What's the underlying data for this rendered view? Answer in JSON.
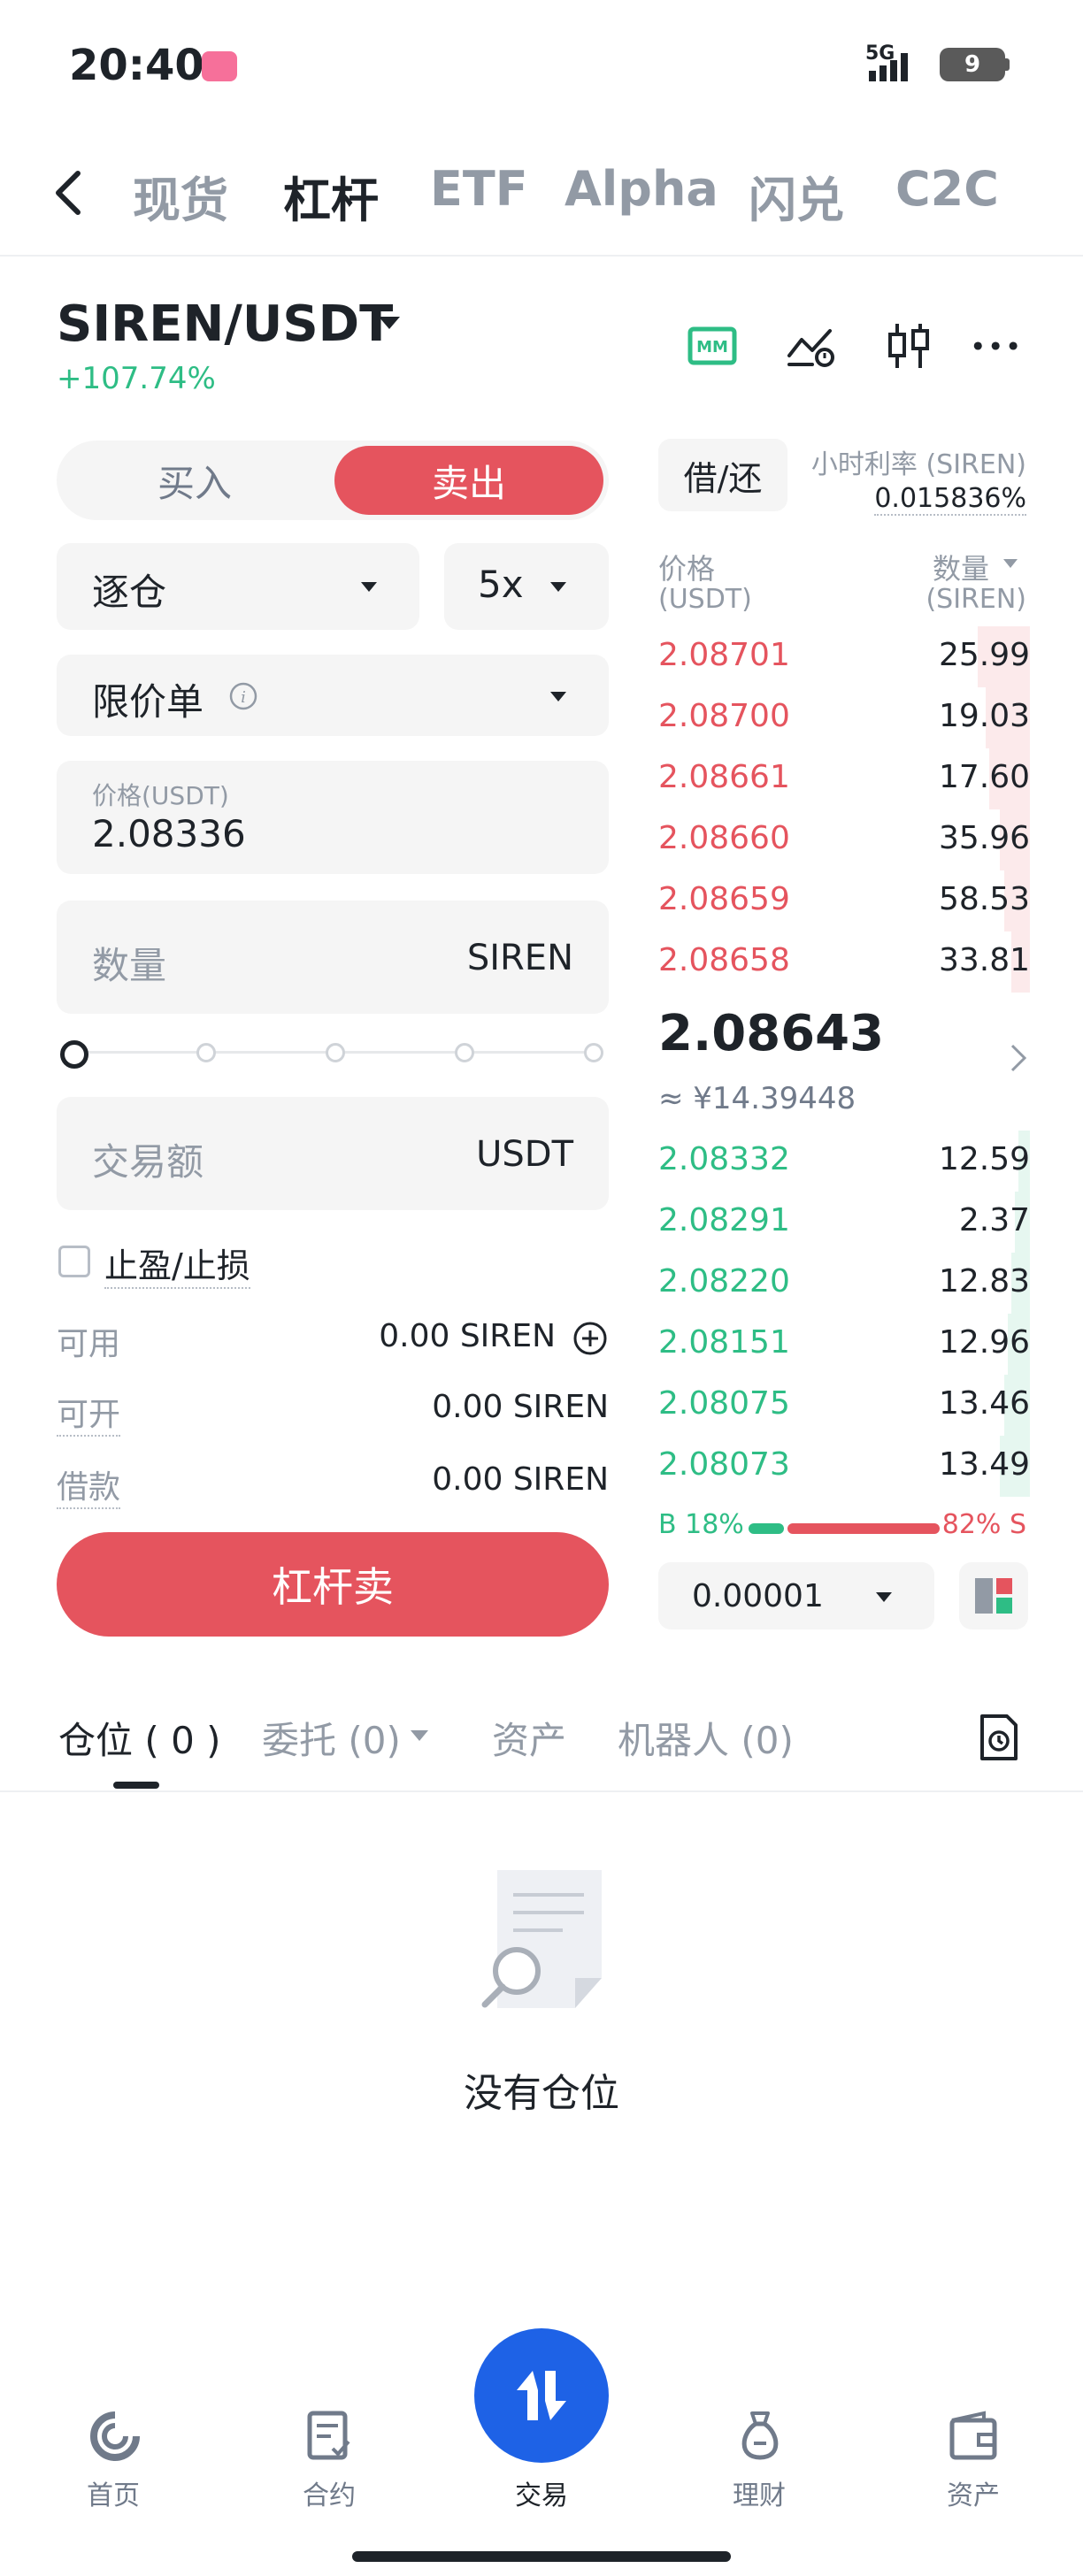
{
  "status": {
    "time": "20:40",
    "network": "5G",
    "battery": "9"
  },
  "nav": {
    "tabs": [
      "现货",
      "杠杆",
      "ETF",
      "Alpha",
      "闪兑",
      "C2C"
    ],
    "active": "杠杆"
  },
  "pair": {
    "symbol": "SIREN/USDT",
    "change": "+107.74%"
  },
  "header_icons": [
    "mm-icon",
    "price-alert-icon",
    "candlestick-icon",
    "more-icon"
  ],
  "form": {
    "buy_label": "买入",
    "sell_label": "卖出",
    "margin_mode": "逐仓",
    "leverage": "5x",
    "order_type": "限价单",
    "price_label": "价格(USDT)",
    "price_value": "2.08336",
    "amount_placeholder": "数量",
    "amount_unit": "SIREN",
    "slider_value": 0,
    "total_placeholder": "交易额",
    "total_unit": "USDT",
    "tpsl_label": "止盈/止损",
    "available_label": "可用",
    "available_value": "0.00 SIREN",
    "openable_label": "可开",
    "openable_value": "0.00 SIREN",
    "borrowed_label": "借款",
    "borrowed_value": "0.00 SIREN",
    "submit_label": "杠杆卖"
  },
  "orderbook": {
    "borrow_btn": "借/还",
    "rate_label": "小时利率 (SIREN)",
    "rate_value": "0.015836%",
    "price_header": "价格",
    "price_unit": "(USDT)",
    "qty_header": "数量",
    "qty_unit": "(SIREN)",
    "asks": [
      {
        "price": "2.08701",
        "qty": "25.99",
        "depth": 0.14
      },
      {
        "price": "2.08700",
        "qty": "19.03",
        "depth": 0.12
      },
      {
        "price": "2.08661",
        "qty": "17.60",
        "depth": 0.11
      },
      {
        "price": "2.08660",
        "qty": "35.96",
        "depth": 0.08
      },
      {
        "price": "2.08659",
        "qty": "58.53",
        "depth": 0.07
      },
      {
        "price": "2.08658",
        "qty": "33.81",
        "depth": 0.05
      }
    ],
    "mid_price": "2.08643",
    "mid_fiat": "≈ ¥14.39448",
    "bids": [
      {
        "price": "2.08332",
        "qty": "12.59",
        "depth": 0.03
      },
      {
        "price": "2.08291",
        "qty": "2.37",
        "depth": 0.04
      },
      {
        "price": "2.08220",
        "qty": "12.83",
        "depth": 0.05
      },
      {
        "price": "2.08151",
        "qty": "12.96",
        "depth": 0.06
      },
      {
        "price": "2.08075",
        "qty": "13.46",
        "depth": 0.07
      },
      {
        "price": "2.08073",
        "qty": "13.49",
        "depth": 0.08
      }
    ],
    "buy_ratio": "B 18%",
    "sell_ratio": "82% S",
    "precision": "0.00001"
  },
  "tabs2": {
    "positions": "仓位 ( 0 )",
    "orders": "委托 (0)",
    "assets": "资产",
    "bots": "机器人 (0)"
  },
  "empty": {
    "text": "没有仓位"
  },
  "bottom_nav": [
    {
      "label": "首页",
      "icon": "home-icon"
    },
    {
      "label": "合约",
      "icon": "futures-icon"
    },
    {
      "label": "交易",
      "icon": "trade-icon"
    },
    {
      "label": "理财",
      "icon": "earn-icon"
    },
    {
      "label": "资产",
      "icon": "wallet-icon"
    }
  ],
  "colors": {
    "red": "#e5545e",
    "green": "#2ebd85",
    "blue": "#1e62e6"
  }
}
